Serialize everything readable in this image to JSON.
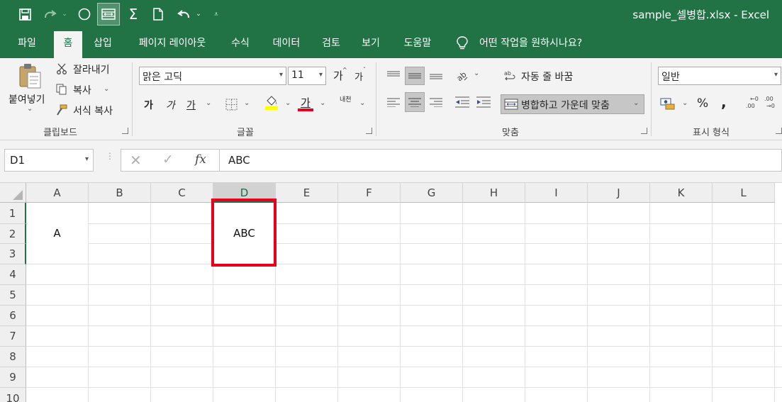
{
  "titlebar": {
    "title": "sample_셀병합.xlsx  -  Excel"
  },
  "tabs": [
    "파일",
    "홈",
    "삽입",
    "페이지 레이아웃",
    "수식",
    "데이터",
    "검토",
    "보기",
    "도움말"
  ],
  "tellme": {
    "text": "어떤 작업을 원하시나요?"
  },
  "clipboard": {
    "paste": "붙여넣기",
    "cut": "잘라내기",
    "copy": "복사",
    "format_painter": "서식 복사",
    "group": "클립보드"
  },
  "font": {
    "name": "맑은 고딕",
    "size": "11",
    "grow": "가",
    "shrink": "가",
    "bold": "가",
    "italic": "가",
    "underline": "가",
    "fill": "가",
    "color": "가",
    "phonetic": "내천",
    "group": "글꼴"
  },
  "alignment": {
    "wrap": "자동 줄 바꿈",
    "merge": "병합하고 가운데 맞춤",
    "group": "맞춤"
  },
  "number": {
    "format": "일반",
    "percent": "%",
    "comma": ",",
    "increase_dec": ".00",
    "decrease_dec": ".00",
    "group": "표시 형식"
  },
  "formula_bar": {
    "name_box": "D1",
    "fx": "fx",
    "value": "ABC"
  },
  "grid": {
    "columns": [
      "A",
      "B",
      "C",
      "D",
      "E",
      "F",
      "G",
      "H",
      "I",
      "J",
      "K",
      "L"
    ],
    "rows": [
      "1",
      "2",
      "3",
      "4",
      "5",
      "6",
      "7",
      "8",
      "9",
      "10"
    ],
    "selected_column": "D",
    "merged": [
      {
        "range": "A1:A3",
        "value": "A"
      },
      {
        "range": "D1:D3",
        "value": "ABC"
      }
    ]
  },
  "colors": {
    "brand": "#217346",
    "highlight": "#e8001c",
    "font_color_bar": "#e8001c",
    "fill_color_bar": "#ffff00"
  }
}
